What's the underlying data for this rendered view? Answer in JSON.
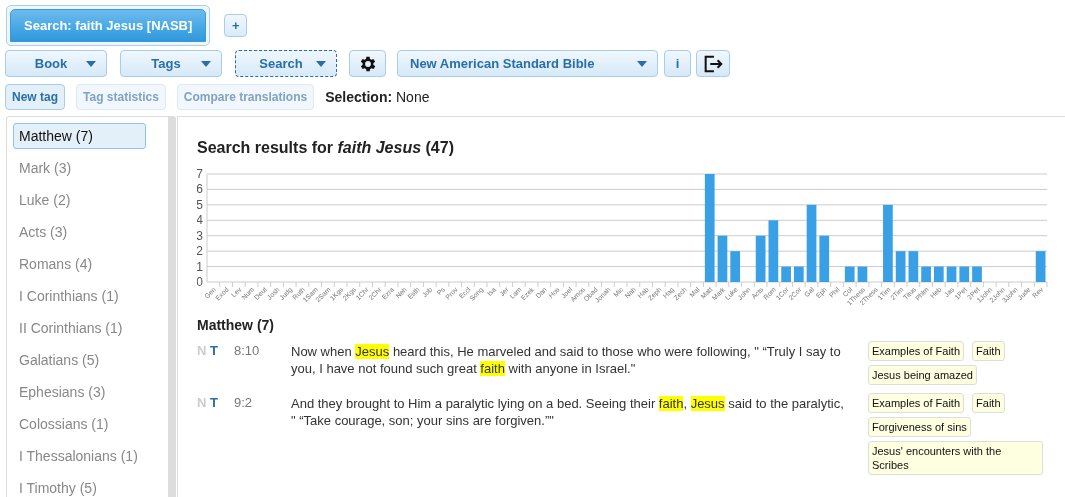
{
  "tabs": [
    {
      "label": "Search: faith Jesus [NASB]",
      "selected": true
    }
  ],
  "add_tab": "+",
  "toolbar": {
    "book": "Book",
    "tags": "Tags",
    "search": "Search",
    "translation": "New American Standard Bible",
    "info": "i"
  },
  "actions": [
    {
      "label": "New tag",
      "disabled": false
    },
    {
      "label": "Tag statistics",
      "disabled": true
    },
    {
      "label": "Compare translations",
      "disabled": true
    }
  ],
  "selection": {
    "label": "Selection:",
    "value": "None"
  },
  "sidebar": {
    "items": [
      {
        "label": "Matthew (7)",
        "selected": true
      },
      {
        "label": "Mark (3)",
        "selected": false
      },
      {
        "label": "Luke (2)",
        "selected": false
      },
      {
        "label": "Acts (3)",
        "selected": false
      },
      {
        "label": "Romans (4)",
        "selected": false
      },
      {
        "label": "I Corinthians (1)",
        "selected": false
      },
      {
        "label": "II Corinthians (1)",
        "selected": false
      },
      {
        "label": "Galatians (5)",
        "selected": false
      },
      {
        "label": "Ephesians (3)",
        "selected": false
      },
      {
        "label": "Colossians (1)",
        "selected": false
      },
      {
        "label": "I Thessalonians (1)",
        "selected": false
      },
      {
        "label": "I Timothy (5)",
        "selected": false
      }
    ]
  },
  "results": {
    "title": "Search results for *faith Jesus* (47)",
    "chart_data": {
      "type": "bar",
      "categories": [
        "Gen",
        "Exod",
        "Lev",
        "Num",
        "Deut",
        "Josh",
        "Judg",
        "Ruth",
        "1Sam",
        "2Sam",
        "1Kgs",
        "2Kgs",
        "1Chr",
        "2Chr",
        "Ezra",
        "Neh",
        "Esth",
        "Job",
        "Ps",
        "Prov",
        "Eccl",
        "Song",
        "Isa",
        "Jer",
        "Lam",
        "Ezek",
        "Dan",
        "Hos",
        "Joel",
        "Amos",
        "Obad",
        "Jonah",
        "Mic",
        "Nah",
        "Hab",
        "Zeph",
        "Hag",
        "Zech",
        "Mal",
        "Matt",
        "Mark",
        "Luke",
        "John",
        "Acts",
        "Rom",
        "1Cor",
        "2Cor",
        "Gal",
        "Eph",
        "Phil",
        "Col",
        "1Thess",
        "2Thess",
        "1Tim",
        "2Tim",
        "Titus",
        "Phlm",
        "Heb",
        "Jas",
        "1Pet",
        "2Pet",
        "1John",
        "2John",
        "3John",
        "Jude",
        "Rev"
      ],
      "grid": true,
      "series": [
        {
          "color": "#3aa0e6",
          "values": [
            0,
            0,
            0,
            0,
            0,
            0,
            0,
            0,
            0,
            0,
            0,
            0,
            0,
            0,
            0,
            0,
            0,
            0,
            0,
            0,
            0,
            0,
            0,
            0,
            0,
            0,
            0,
            0,
            0,
            0,
            0,
            0,
            0,
            0,
            0,
            0,
            0,
            0,
            0,
            7,
            3,
            2,
            0,
            3,
            4,
            1,
            1,
            5,
            3,
            0,
            1,
            1,
            0,
            5,
            2,
            2,
            1,
            1,
            1,
            1,
            1,
            0,
            0,
            0,
            0,
            2
          ]
        }
      ],
      "ylim": [
        0,
        7
      ],
      "yticks": [
        0,
        1,
        2,
        3,
        4,
        5,
        6,
        7
      ]
    },
    "book_heading": "Matthew (7)",
    "verses": [
      {
        "n": "N",
        "t": "T",
        "ref": "8:10",
        "segments": [
          {
            "text": "Now when ",
            "highlight": false
          },
          {
            "text": "Jesus",
            "highlight": true
          },
          {
            "text": " heard this, He marveled and said to those who were following, \" “Truly I say to you, I have not found such great ",
            "highlight": false
          },
          {
            "text": "faith",
            "highlight": true
          },
          {
            "text": " with anyone in Israel.\"",
            "highlight": false
          }
        ],
        "tags": [
          "Examples of Faith",
          "Faith",
          "Jesus being amazed"
        ]
      },
      {
        "n": "N",
        "t": "T",
        "ref": "9:2",
        "segments": [
          {
            "text": "And they brought to Him a paralytic lying on a bed. Seeing their ",
            "highlight": false
          },
          {
            "text": "faith",
            "highlight": true
          },
          {
            "text": ", ",
            "highlight": false
          },
          {
            "text": "Jesus",
            "highlight": true
          },
          {
            "text": " said to the paralytic, \" “Take courage, son; your sins are forgiven.”\"",
            "highlight": false
          }
        ],
        "tags": [
          "Examples of Faith",
          "Faith",
          "Forgiveness of sins",
          "Jesus' encounters with the Scribes"
        ]
      }
    ]
  }
}
